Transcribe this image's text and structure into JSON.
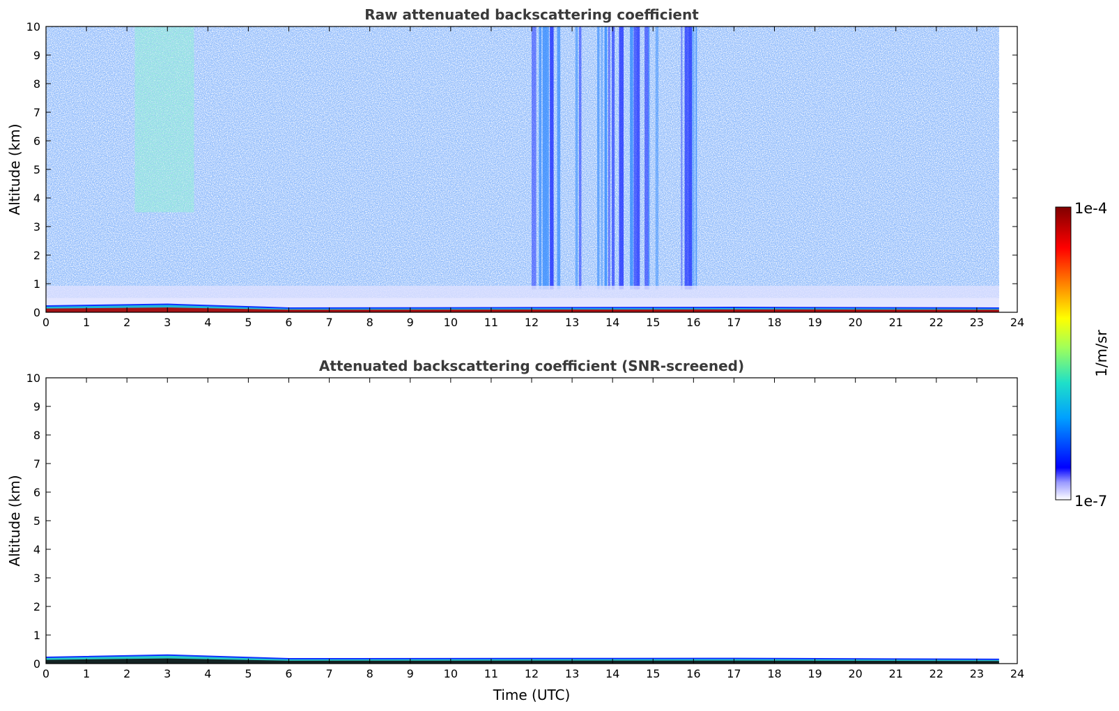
{
  "chart_data": [
    {
      "type": "heatmap",
      "title": "Raw attenuated backscattering coefficient",
      "xlabel": "",
      "ylabel": "Altitude (km)",
      "xlim": [
        0,
        24
      ],
      "ylim": [
        0,
        10
      ],
      "x_ticks": [
        0,
        1,
        2,
        3,
        4,
        5,
        6,
        7,
        8,
        9,
        10,
        11,
        12,
        13,
        14,
        15,
        16,
        17,
        18,
        19,
        20,
        21,
        22,
        23,
        24
      ],
      "y_ticks": [
        0,
        1,
        2,
        3,
        4,
        5,
        6,
        7,
        8,
        9,
        10
      ],
      "data_x_extent": [
        0,
        23.55
      ],
      "features": [
        {
          "label": "boundary layer",
          "x_range": [
            0,
            23.55
          ],
          "top_km": [
            [
              0,
              0.22
            ],
            [
              3,
              0.28
            ],
            [
              6,
              0.15
            ],
            [
              17,
              0.17
            ],
            [
              23.55,
              0.15
            ]
          ],
          "level": "high"
        },
        {
          "label": "enhanced signal",
          "x_range": [
            2.2,
            3.65
          ],
          "y_range": [
            3.5,
            10
          ],
          "level": "medium"
        },
        {
          "label": "vertical streaks",
          "x_range": [
            12.0,
            16.1
          ],
          "y_range": [
            0.8,
            10
          ],
          "level": "low-medium"
        }
      ]
    },
    {
      "type": "heatmap",
      "title": "Attenuated backscattering coefficient (SNR-screened)",
      "xlabel": "Time (UTC)",
      "ylabel": "Altitude (km)",
      "xlim": [
        0,
        24
      ],
      "ylim": [
        0,
        10
      ],
      "x_ticks": [
        0,
        1,
        2,
        3,
        4,
        5,
        6,
        7,
        8,
        9,
        10,
        11,
        12,
        13,
        14,
        15,
        16,
        17,
        18,
        19,
        20,
        21,
        22,
        23,
        24
      ],
      "y_ticks": [
        0,
        1,
        2,
        3,
        4,
        5,
        6,
        7,
        8,
        9,
        10
      ],
      "data_x_extent": [
        0,
        23.55
      ],
      "features": [
        {
          "label": "boundary layer",
          "x_range": [
            0,
            23.55
          ],
          "top_km": [
            [
              0,
              0.22
            ],
            [
              3,
              0.3
            ],
            [
              6,
              0.17
            ],
            [
              17,
              0.18
            ],
            [
              23.55,
              0.15
            ]
          ],
          "level": "high"
        }
      ]
    }
  ],
  "colorbar": {
    "label": "1/m/sr",
    "min_label": "1e-7",
    "max_label": "1e-4",
    "scale": "log",
    "colormap": [
      "#ffffff",
      "#0000ff",
      "#00a0ff",
      "#1fe0c8",
      "#a0ff5a",
      "#ffff00",
      "#ff8000",
      "#ff0000",
      "#800000"
    ]
  }
}
